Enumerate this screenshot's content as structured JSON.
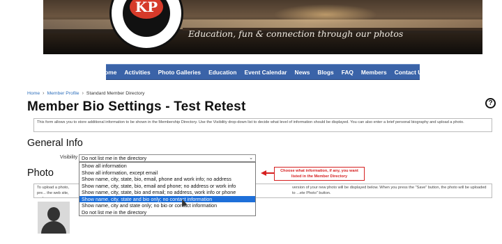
{
  "banner": {
    "logo_text": "KP",
    "logo_ring_text": "Long Island, New York",
    "tagline": "Education, fun & connection through our photos"
  },
  "nav": {
    "items": [
      "Home",
      "Activities",
      "Photo Galleries",
      "Education",
      "Event Calendar",
      "News",
      "Blogs",
      "FAQ",
      "Members",
      "Contact Us"
    ]
  },
  "breadcrumb": {
    "home": "Home",
    "member_profile": "Member Profile",
    "current": "Standard Member Directory"
  },
  "page": {
    "title": "Member Bio Settings - Test Retest",
    "help_glyph": "?",
    "info_text": "This form allows you to store additional information to be shown in the Membership Directory. Use the Visibility drop-down list to decide what level of information should be displayed. You can also enter a brief personal biography and upload a photo."
  },
  "general": {
    "heading": "General Info",
    "visibility_label": "Visibility",
    "visibility_value": "Do not list me in the directory",
    "options": [
      "Show all information",
      "Show all information, except email",
      "Show name, city, state, bio, email, phone and work info; no address",
      "Show name, city, state, bio, email and phone; no address or work info",
      "Show name, city, state, bio and email; no address, work info or phone",
      "Show name, city, state and bio only; no contact information",
      "Show name, city and state only; no bio or contact information",
      "Do not list me in the directory"
    ],
    "highlighted_index": 5
  },
  "photo": {
    "heading": "Photo",
    "info_left": "To upload a photo, pre... the web site, replace",
    "info_right": "version of your new photo will be displayed below. When you press the \"Save\" button, the photo will be uploaded to ...ete Photo\" button."
  },
  "callout": {
    "text": "Choose what information, if any, you want listed in the Member Directory"
  },
  "colors": {
    "nav_bg": "#3a63a8",
    "link": "#2e6fbb",
    "selected_option": "#1e6fd9",
    "callout": "#d61f1f"
  }
}
